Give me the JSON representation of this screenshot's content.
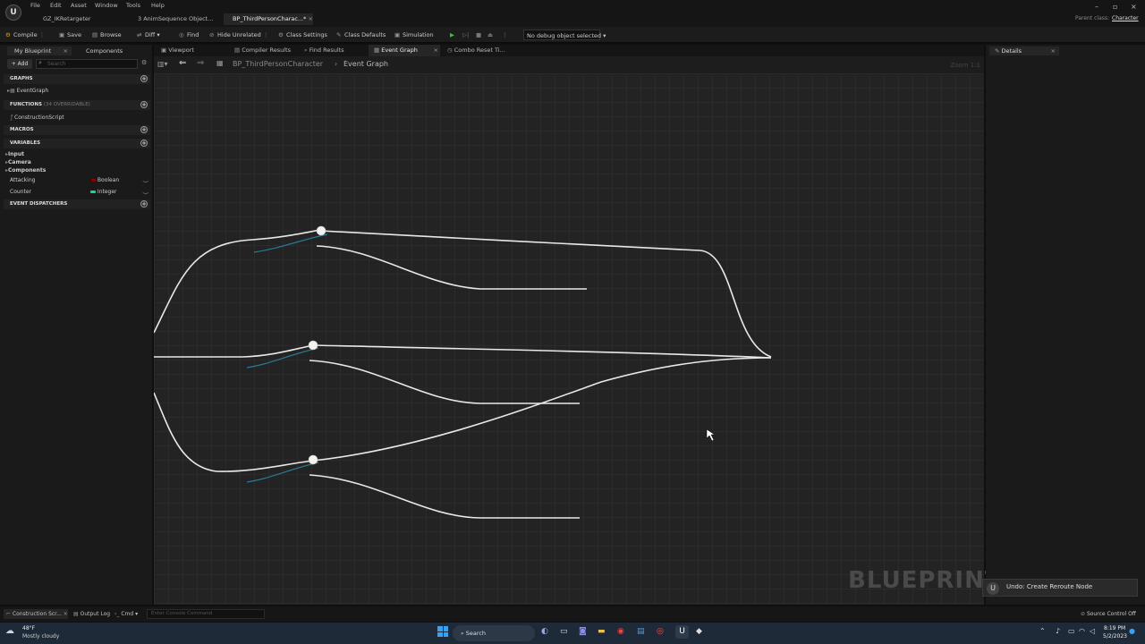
{
  "menu": [
    "File",
    "Edit",
    "Asset",
    "Window",
    "Tools",
    "Help"
  ],
  "tabs": [
    {
      "label": "GZ_IKRetargeter"
    },
    {
      "label": "3 AnimSequence Object..."
    },
    {
      "label": "BP_ThirdPersonCharac...*"
    }
  ],
  "parent_class": {
    "label": "Parent class:",
    "value": "Character"
  },
  "toolbar": {
    "compile": "Compile",
    "save": "Save",
    "browse": "Browse",
    "diff": "Diff",
    "find": "Find",
    "hide_unrelated": "Hide Unrelated",
    "class_settings": "Class Settings",
    "class_defaults": "Class Defaults",
    "simulation": "Simulation",
    "debug_select": "No debug object selected"
  },
  "left_panel": {
    "tabs": [
      "My Blueprint",
      "Components"
    ],
    "add": "+ Add",
    "search_placeholder": "Search",
    "sections": {
      "graphs": "GRAPHS",
      "functions": "FUNCTIONS",
      "functions_note": "(34 OVERRIDABLE)",
      "macros": "MACROS",
      "variables": "VARIABLES",
      "event_dispatchers": "EVENT DISPATCHERS"
    },
    "event_graph": "EventGraph",
    "construction_script": "ConstructionScript",
    "var_groups": [
      "Input",
      "Camera",
      "Components"
    ],
    "variables": [
      {
        "name": "Attacking",
        "type": "Boolean",
        "color": "#8b0000"
      },
      {
        "name": "Counter",
        "type": "Integer",
        "color": "#1fd1a1"
      }
    ]
  },
  "doc_tabs": [
    "Viewport",
    "Compiler Results",
    "Find Results",
    "Event Graph",
    "Combo Reset Ti..."
  ],
  "breadcrumb": {
    "root": "BP_ThirdPersonCharacter",
    "current": "Event Graph"
  },
  "zoom": "Zoom 1:1",
  "details_tab": "Details",
  "watermark": "BLUEPRINT",
  "toast": "Undo: Create Reroute Node",
  "status": {
    "construction": "Construction Scr...",
    "output_log": "Output Log",
    "cmd": "Cmd",
    "console_placeholder": "Enter Console Command",
    "source_control": "Source Control Off"
  },
  "taskbar": {
    "weather_temp": "48°F",
    "weather_text": "Mostly cloudy",
    "search": "Search",
    "time": "8:19 PM",
    "date": "5/2/2023"
  },
  "colors": {
    "wire": "#e8e8e8",
    "exec_accent": "#2a8fb0",
    "graph_bg": "#232323"
  }
}
